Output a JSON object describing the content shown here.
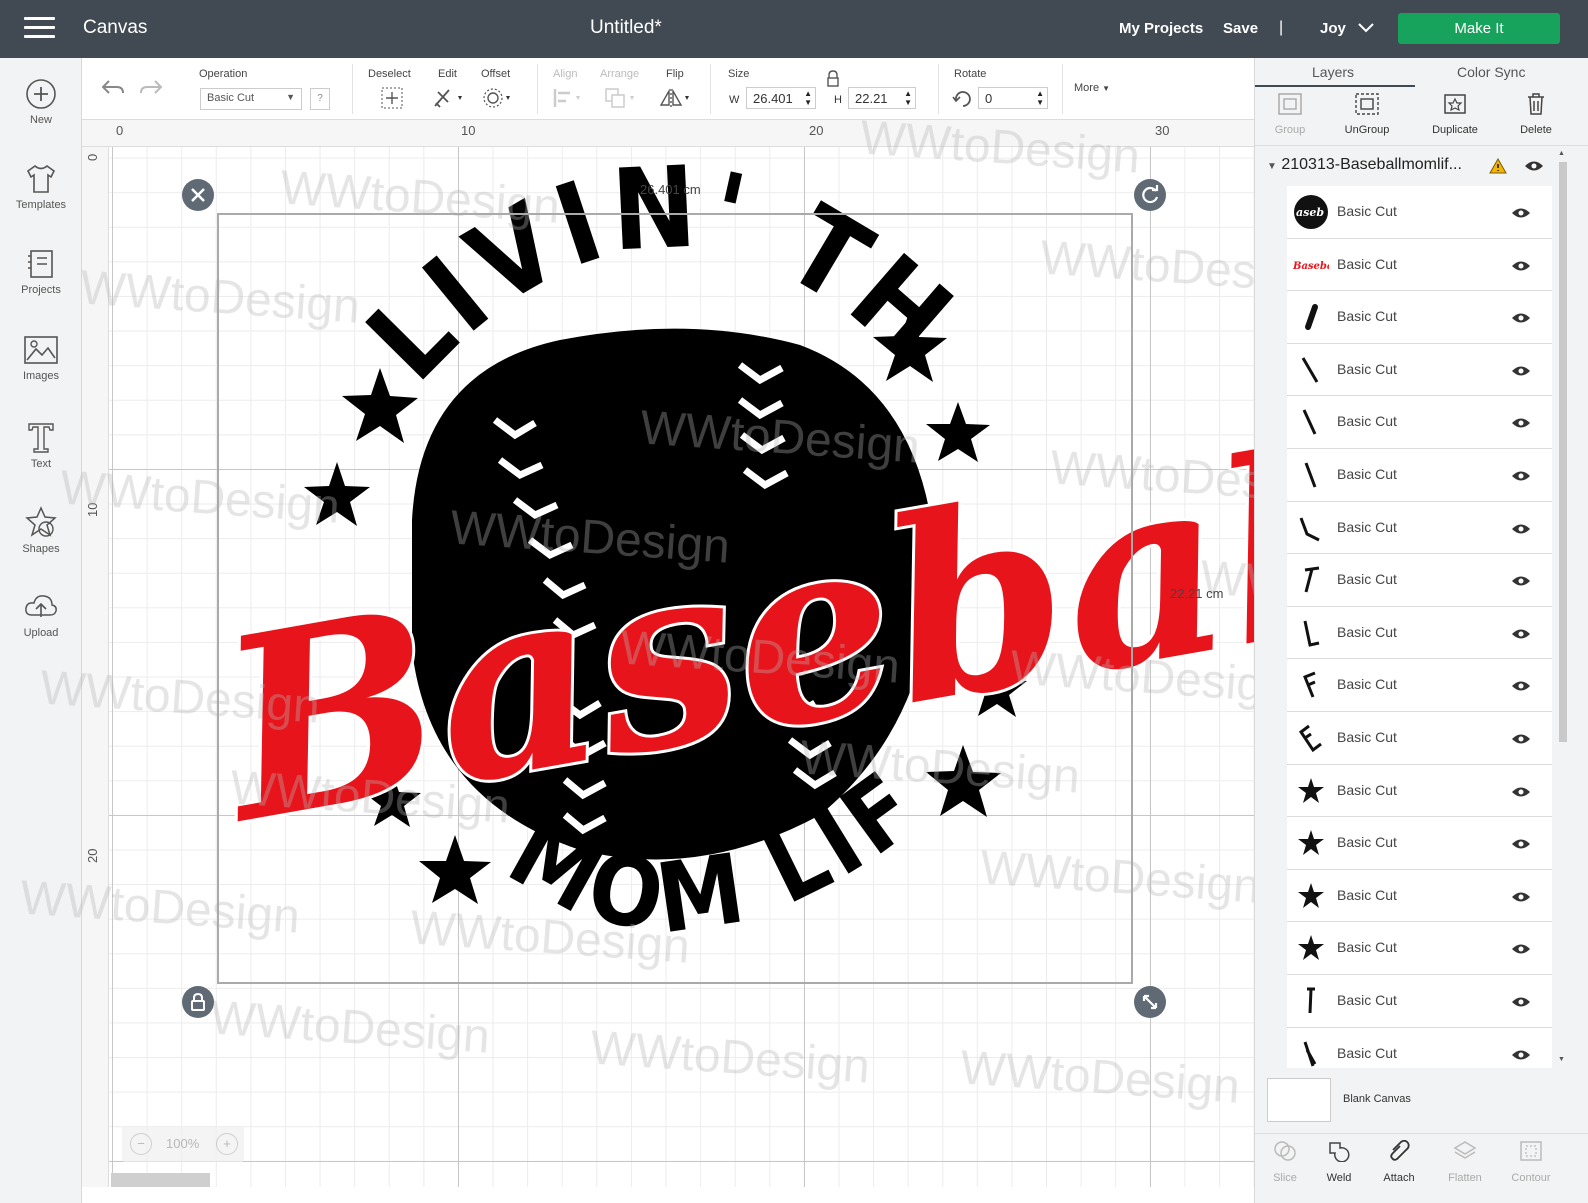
{
  "topbar": {
    "app_title": "Canvas",
    "doc_title": "Untitled*",
    "my_projects": "My Projects",
    "save": "Save",
    "separator": "|",
    "user": "Joy",
    "make_it": "Make It",
    "accent_color": "#17a35b"
  },
  "sidebar": {
    "items": [
      {
        "label": "New",
        "icon": "plus-circle-icon"
      },
      {
        "label": "Templates",
        "icon": "tshirt-icon"
      },
      {
        "label": "Projects",
        "icon": "projects-icon"
      },
      {
        "label": "Images",
        "icon": "image-icon"
      },
      {
        "label": "Text",
        "icon": "text-icon"
      },
      {
        "label": "Shapes",
        "icon": "shapes-icon"
      },
      {
        "label": "Upload",
        "icon": "upload-cloud-icon"
      }
    ]
  },
  "toolbar": {
    "operation_label": "Operation",
    "operation_value": "Basic Cut",
    "help": "?",
    "deselect_label": "Deselect",
    "edit_label": "Edit",
    "offset_label": "Offset",
    "align_label": "Align",
    "arrange_label": "Arrange",
    "flip_label": "Flip",
    "size_label": "Size",
    "w_label": "W",
    "width_value": "26.401",
    "h_label": "H",
    "height_value": "22.21",
    "rotate_label": "Rotate",
    "rotate_value": "0",
    "more_label": "More"
  },
  "rulers": {
    "horizontal": [
      "0",
      "10",
      "20",
      "30"
    ],
    "vertical": [
      "0",
      "10",
      "20"
    ]
  },
  "canvas": {
    "width_dim": "26.401 cm",
    "height_dim": "22.21 cm",
    "zoom": "100%",
    "watermark": "WWtoDesign",
    "design_text_top": "LIVIN' THAT",
    "design_text_main": "Baseball",
    "design_text_bottom": "MOM LIFE",
    "design_colors": {
      "black": "#000000",
      "red": "#e8141b"
    }
  },
  "panel": {
    "tabs": [
      "Layers",
      "Color Sync"
    ],
    "actions": [
      {
        "label": "Group",
        "enabled": false
      },
      {
        "label": "UnGroup",
        "enabled": true
      },
      {
        "label": "Duplicate",
        "enabled": true
      },
      {
        "label": "Delete",
        "enabled": true
      }
    ],
    "group_title": "210313-Baseballmomlif...",
    "layers": [
      {
        "label": "Basic Cut",
        "thumb": "baseball-ball-thumb"
      },
      {
        "label": "Basic Cut",
        "thumb": "baseball-text-thumb"
      },
      {
        "label": "Basic Cut",
        "thumb": "stroke-thumb"
      },
      {
        "label": "Basic Cut",
        "thumb": "stroke-thumb"
      },
      {
        "label": "Basic Cut",
        "thumb": "stroke-thumb"
      },
      {
        "label": "Basic Cut",
        "thumb": "stroke-thumb"
      },
      {
        "label": "Basic Cut",
        "thumb": "stroke-thumb"
      },
      {
        "label": "Basic Cut",
        "thumb": "letter-t-thumb"
      },
      {
        "label": "Basic Cut",
        "thumb": "letter-l-thumb"
      },
      {
        "label": "Basic Cut",
        "thumb": "letter-f-thumb"
      },
      {
        "label": "Basic Cut",
        "thumb": "letter-e-thumb"
      },
      {
        "label": "Basic Cut",
        "thumb": "star-thumb"
      },
      {
        "label": "Basic Cut",
        "thumb": "star-thumb"
      },
      {
        "label": "Basic Cut",
        "thumb": "star-thumb"
      },
      {
        "label": "Basic Cut",
        "thumb": "star-thumb"
      },
      {
        "label": "Basic Cut",
        "thumb": "letter-i-thumb"
      },
      {
        "label": "Basic Cut",
        "thumb": "stroke-thumb"
      }
    ],
    "blank_canvas": "Blank Canvas",
    "bottom_actions": [
      {
        "label": "Slice",
        "enabled": false
      },
      {
        "label": "Weld",
        "enabled": true
      },
      {
        "label": "Attach",
        "enabled": true
      },
      {
        "label": "Flatten",
        "enabled": false
      },
      {
        "label": "Contour",
        "enabled": false
      }
    ]
  }
}
